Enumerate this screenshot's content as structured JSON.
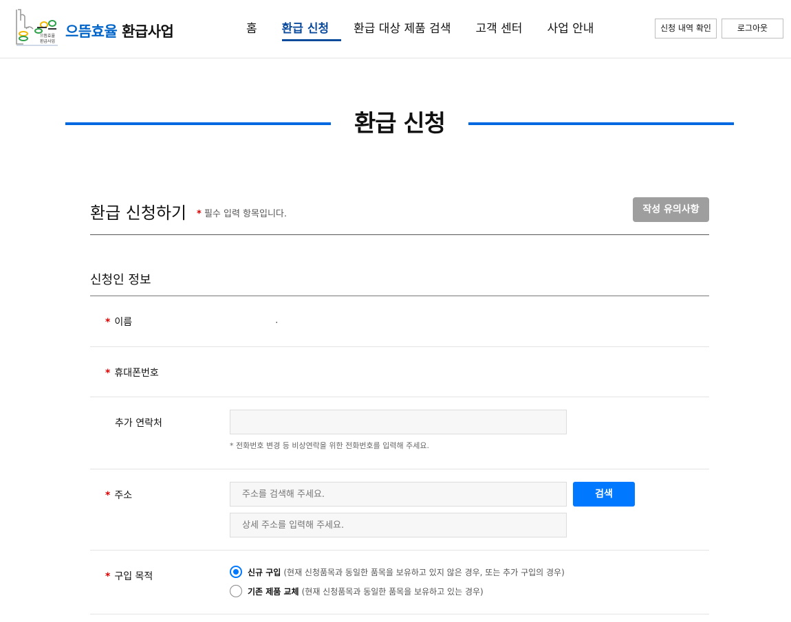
{
  "header": {
    "logo_text_a": "으뜸효율",
    "logo_text_b": "환급사업",
    "logo_mark_text_1": "으뜸효율",
    "logo_mark_text_2": "환급사업",
    "nav": [
      {
        "label": "홈"
      },
      {
        "label": "환급 신청",
        "active": true
      },
      {
        "label": "환급 대상 제품 검색"
      },
      {
        "label": "고객 센터"
      },
      {
        "label": "사업 안내"
      }
    ],
    "history_button": "신청 내역 확인",
    "logout_button": "로그아웃"
  },
  "page_title": "환급 신청",
  "form": {
    "title": "환급 신청하기",
    "required_mark": "*",
    "required_note": "필수 입력 항목입니다.",
    "guide_button": "작성 유의사항"
  },
  "applicant": {
    "section_title": "신청인 정보",
    "name_label": "이름",
    "name_value": ".",
    "phone_label": "휴대폰번호",
    "extra_contact_label": "추가 연락처",
    "extra_contact_value": "",
    "extra_contact_hint": "* 전화번호 변경 등 비상연락을 위한 전화번호를 입력해 주세요.",
    "address_label": "주소",
    "address_placeholder": "주소를 검색해 주세요.",
    "address_detail_placeholder": "상세 주소를 입력해 주세요.",
    "search_button": "검색",
    "purpose_label": "구입 목적",
    "purpose_options": [
      {
        "label": "신규 구입",
        "desc": "(현재 신청품목과 동일한 품목을 보유하고 있지 않은 경우, 또는 추가 구입의 경우)",
        "selected": true
      },
      {
        "label": "기존 제품 교체",
        "desc": "(현재 신청품목과 동일한 품목을 보유하고 있는 경우)",
        "selected": false
      }
    ]
  },
  "colors": {
    "brand_blue": "#0064c8",
    "accent_blue": "#0078ff",
    "required_red": "#e00000",
    "guide_gray": "#9e9e9e"
  }
}
